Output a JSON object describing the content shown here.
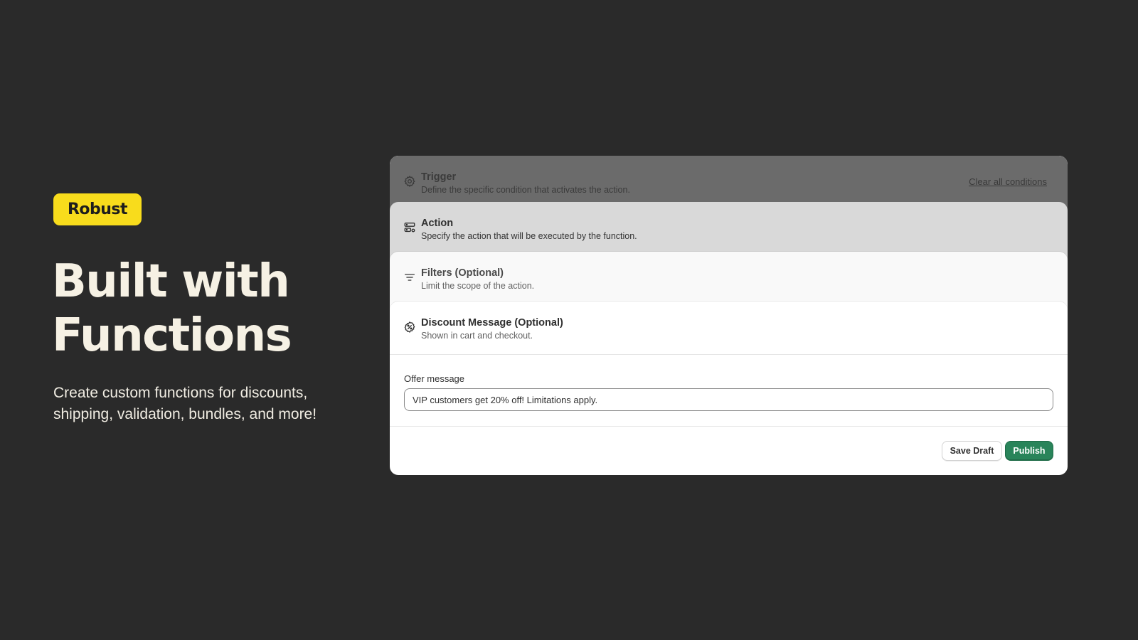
{
  "hero": {
    "badge": "Robust",
    "headline_line1": "Built with",
    "headline_line2": "Functions",
    "subcopy": "Create custom functions for discounts, shipping, validation, bundles, and more!"
  },
  "panel": {
    "trigger": {
      "title": "Trigger",
      "description": "Define the specific condition that activates the action.",
      "icon": "gear-icon",
      "clear_link": "Clear all conditions"
    },
    "action": {
      "title": "Action",
      "description": "Specify the action that will be executed by the function.",
      "icon": "server-gear-icon"
    },
    "filters": {
      "title": "Filters (Optional)",
      "description": "Limit the scope of the action.",
      "icon": "filter-icon"
    },
    "discount": {
      "title": "Discount Message (Optional)",
      "description": "Shown in cart and checkout.",
      "icon": "discount-badge-icon"
    },
    "offer": {
      "label": "Offer message",
      "value": "VIP customers get 20% off! Limitations apply."
    },
    "buttons": {
      "save_draft": "Save Draft",
      "publish": "Publish"
    }
  },
  "colors": {
    "background": "#2a2a2a",
    "badge": "#f8dc1c",
    "headline": "#f6f1e4",
    "publish": "#29845a"
  }
}
